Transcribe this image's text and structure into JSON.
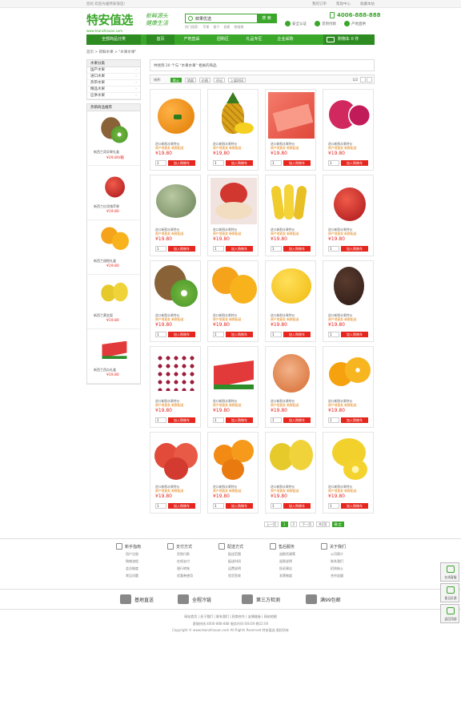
{
  "topbar": {
    "welcome": "您好,欢迎光临特安值选!",
    "links": [
      "我的订单",
      "帮助中心",
      "收藏本站"
    ]
  },
  "logo": {
    "name": "特安值选",
    "url": "www.teanzhixuan.com"
  },
  "slogan": {
    "line1": "新鲜源头",
    "line2": "健康生活"
  },
  "search": {
    "value": "鲜果优选",
    "button": "搜 索"
  },
  "hotwords": [
    "热门搜索:",
    "苹果",
    "橙子",
    "香蕉",
    "猕猴桃"
  ],
  "hotline": "4006-888-888",
  "badges": [
    "安全认证",
    "货到付款",
    "产地直供"
  ],
  "nav": {
    "all": "全部商品分类",
    "items": [
      "首页",
      "产地直采",
      "团购区",
      "礼品专区",
      "企业采购"
    ],
    "active_index": 0,
    "cart": "购物车 0 件"
  },
  "breadcrumb": "首页 > 新鲜水果 > \"水果水果\"",
  "sidebar": {
    "category_title": "水果分类",
    "categories": [
      "国产水果",
      "进口水果",
      "热带水果",
      "精品水果",
      "应季水果"
    ],
    "hot_title": "热销商品推荐",
    "hot_items": [
      {
        "name": "新西兰奇异果礼盒",
        "price": "¥29.80/箱",
        "img": "kiwi-image"
      },
      {
        "name": "新西兰红玫瑰苹果",
        "price": "¥19.80",
        "img": "apple-image"
      },
      {
        "name": "新西兰甜橙礼盒",
        "price": "¥19.80",
        "img": "orange-image"
      },
      {
        "name": "新西兰黄金梨",
        "price": "¥19.80",
        "img": "pear-image"
      },
      {
        "name": "新西兰西瓜礼盒",
        "price": "¥19.80",
        "img": "watermelon-image"
      }
    ]
  },
  "result": {
    "text": "共找到 20 个与 \"水果水果\" 相关的商品"
  },
  "sort": {
    "label": "排序:",
    "options": [
      "默认",
      "销量",
      "价格",
      "评论",
      "上架时间"
    ],
    "active": 0,
    "page": "1/2"
  },
  "products": [
    {
      "name": "进口新鲜水果特价",
      "sub": "原产地直发 新鲜配送",
      "price": "¥19.80",
      "qty": "1",
      "btn": "加入购物车",
      "fruit": "pear"
    },
    {
      "name": "进口新鲜水果特价",
      "sub": "原产地直发 新鲜配送",
      "price": "¥19.80",
      "qty": "1",
      "btn": "加入购物车",
      "fruit": "pineapple"
    },
    {
      "name": "进口新鲜水果特价",
      "sub": "原产地直发 新鲜配送",
      "price": "¥19.80",
      "qty": "1",
      "btn": "加入购物车",
      "fruit": "grapefruit"
    },
    {
      "name": "进口新鲜水果特价",
      "sub": "原产地直发 新鲜配送",
      "price": "¥19.80",
      "qty": "1",
      "btn": "加入购物车",
      "fruit": "dragonfruit"
    },
    {
      "name": "进口新鲜水果特价",
      "sub": "原产地直发 新鲜配送",
      "price": "¥19.80",
      "qty": "1",
      "btn": "加入购物车",
      "fruit": "melon"
    },
    {
      "name": "进口新鲜水果特价",
      "sub": "原产地直发 新鲜配送",
      "price": "¥19.80",
      "qty": "1",
      "btn": "加入购物车",
      "fruit": "apple-slice"
    },
    {
      "name": "进口新鲜水果特价",
      "sub": "原产地直发 新鲜配送",
      "price": "¥19.80",
      "qty": "1",
      "btn": "加入购物车",
      "fruit": "banana"
    },
    {
      "name": "进口新鲜水果特价",
      "sub": "原产地直发 新鲜配送",
      "price": "¥19.80",
      "qty": "1",
      "btn": "加入购物车",
      "fruit": "red-pear"
    },
    {
      "name": "进口新鲜水果特价",
      "sub": "原产地直发 新鲜配送",
      "price": "¥19.80",
      "qty": "1",
      "btn": "加入购物车",
      "fruit": "kiwi"
    },
    {
      "name": "进口新鲜水果特价",
      "sub": "原产地直发 新鲜配送",
      "price": "¥19.80",
      "qty": "1",
      "btn": "加入购物车",
      "fruit": "orange"
    },
    {
      "name": "进口新鲜水果特价",
      "sub": "原产地直发 新鲜配送",
      "price": "¥19.80",
      "qty": "1",
      "btn": "加入购物车",
      "fruit": "lemon"
    },
    {
      "name": "进口新鲜水果特价",
      "sub": "原产地直发 新鲜配送",
      "price": "¥19.80",
      "qty": "1",
      "btn": "加入购物车",
      "fruit": "avocado"
    },
    {
      "name": "进口新鲜水果特价",
      "sub": "原产地直发 新鲜配送",
      "price": "¥19.80",
      "qty": "1",
      "btn": "加入购物车",
      "fruit": "grape"
    },
    {
      "name": "进口新鲜水果特价",
      "sub": "原产地直发 新鲜配送",
      "price": "¥19.80",
      "qty": "1",
      "btn": "加入购物车",
      "fruit": "watermelon"
    },
    {
      "name": "进口新鲜水果特价",
      "sub": "原产地直发 新鲜配送",
      "price": "¥19.80",
      "qty": "1",
      "btn": "加入购物车",
      "fruit": "pomegranate"
    },
    {
      "name": "进口新鲜水果特价",
      "sub": "原产地直发 新鲜配送",
      "price": "¥19.80",
      "qty": "1",
      "btn": "加入购物车",
      "fruit": "orange2"
    },
    {
      "name": "进口新鲜水果特价",
      "sub": "原产地直发 新鲜配送",
      "price": "¥19.80",
      "qty": "1",
      "btn": "加入购物车",
      "fruit": "red-apple"
    },
    {
      "name": "进口新鲜水果特价",
      "sub": "原产地直发 新鲜配送",
      "price": "¥19.80",
      "qty": "1",
      "btn": "加入购物车",
      "fruit": "tangerine"
    },
    {
      "name": "进口新鲜水果特价",
      "sub": "原产地直发 新鲜配送",
      "price": "¥19.80",
      "qty": "1",
      "btn": "加入购物车",
      "fruit": "quince"
    },
    {
      "name": "进口新鲜水果特价",
      "sub": "原产地直发 新鲜配送",
      "price": "¥19.80",
      "qty": "1",
      "btn": "加入购物车",
      "fruit": "lemon2"
    }
  ],
  "pager": [
    "上一页",
    "1",
    "2",
    "下一页",
    "共2页",
    "确 定"
  ],
  "pager_current": 1,
  "footer": {
    "cols": [
      {
        "title": "新手指南",
        "links": [
          "用户注册",
          "购物流程",
          "会员制度",
          "常见问题"
        ]
      },
      {
        "title": "支付方式",
        "links": [
          "货到付款",
          "在线支付",
          "银行转账",
          "优惠券使用"
        ]
      },
      {
        "title": "配送方式",
        "links": [
          "配送范围",
          "配送时间",
          "运费说明",
          "验货签收"
        ]
      },
      {
        "title": "售后服务",
        "links": [
          "退换货政策",
          "退款说明",
          "投诉建议",
          "发票制度"
        ]
      },
      {
        "title": "关于我们",
        "links": [
          "公司简介",
          "联系我们",
          "招贤纳士",
          "合作加盟"
        ]
      }
    ],
    "services": [
      "基地直送",
      "全程冷链",
      "第三方检测",
      "满99包邮"
    ],
    "links": "网站首页 | 关于我们 | 联系我们 | 招商合作 | 友情链接 | 网站地图",
    "info1": "客服热线:4006-888-888  服务时间:早8:00-晚22:00",
    "info2": "Copyright © www.teanzhixuan.com All Rights Reserved 特安值选 版权所有"
  },
  "floatbar": [
    "在线客服",
    "意见反馈",
    "返回顶部"
  ],
  "colors": {
    "brand": "#3aa62a",
    "price": "#e5271f",
    "accent": "#e07a00"
  }
}
